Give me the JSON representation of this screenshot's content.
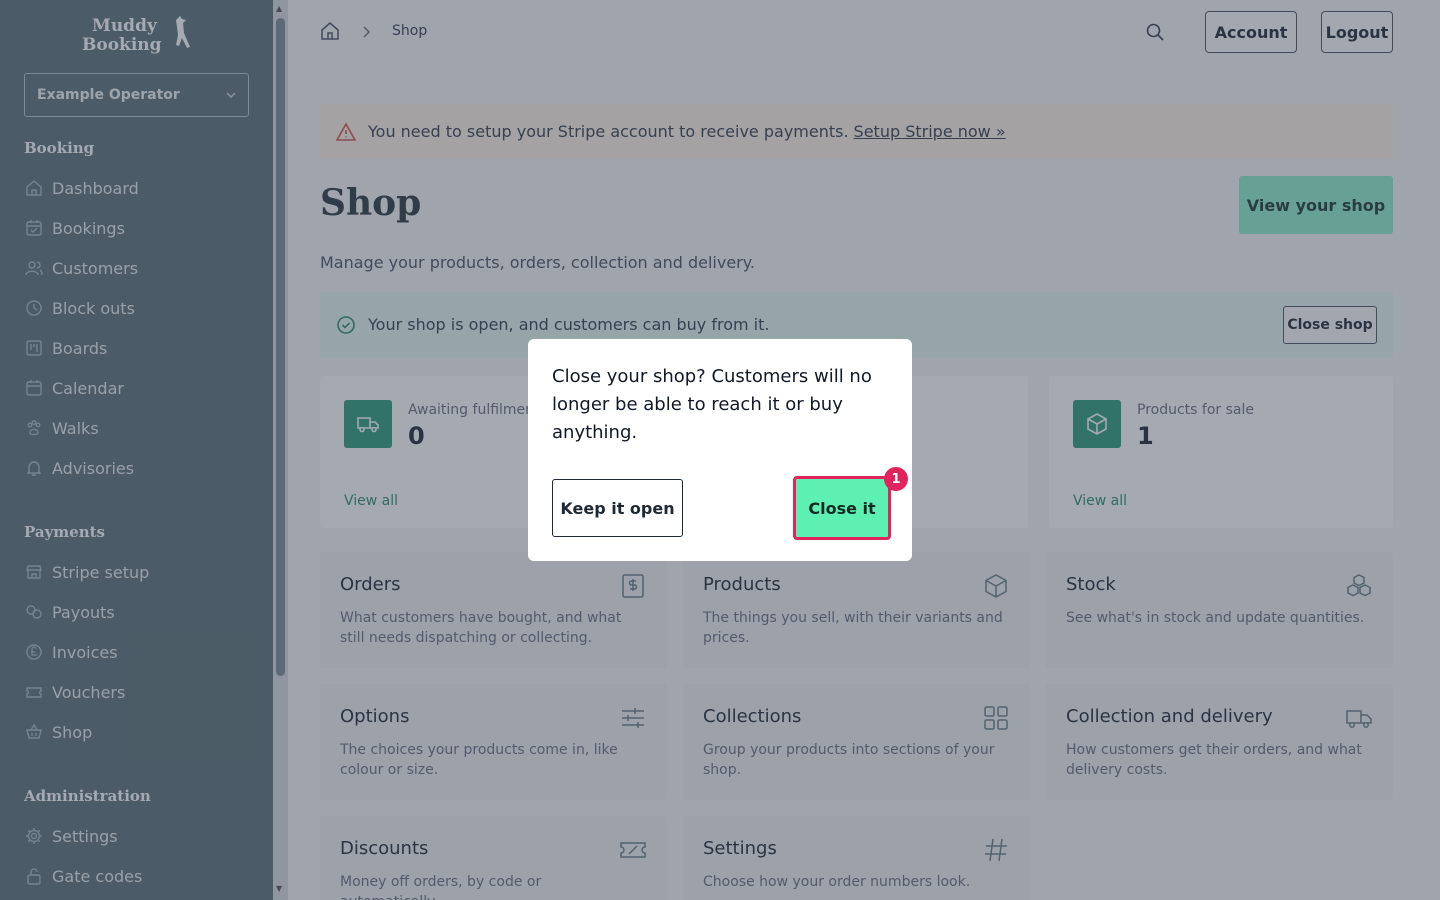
{
  "sidebar": {
    "logo_text": "Muddy Booking",
    "operator": "Example Operator",
    "sections": [
      {
        "title": "Booking"
      },
      {
        "title": "Payments"
      },
      {
        "title": "Administration"
      }
    ],
    "booking_items": [
      {
        "label": "Dashboard",
        "icon": "home-icon"
      },
      {
        "label": "Bookings",
        "icon": "calendar-check-icon"
      },
      {
        "label": "Customers",
        "icon": "users-icon"
      },
      {
        "label": "Block outs",
        "icon": "clock-icon"
      },
      {
        "label": "Boards",
        "icon": "board-icon"
      },
      {
        "label": "Calendar",
        "icon": "calendar-icon"
      },
      {
        "label": "Walks",
        "icon": "paw-icon"
      },
      {
        "label": "Advisories",
        "icon": "bell-icon"
      }
    ],
    "payment_items": [
      {
        "label": "Stripe setup",
        "icon": "store-icon"
      },
      {
        "label": "Payouts",
        "icon": "coins-icon"
      },
      {
        "label": "Invoices",
        "icon": "pound-icon"
      },
      {
        "label": "Vouchers",
        "icon": "ticket-icon"
      },
      {
        "label": "Shop",
        "icon": "basket-icon"
      }
    ],
    "admin_items": [
      {
        "label": "Settings",
        "icon": "gear-icon"
      },
      {
        "label": "Gate codes",
        "icon": "lock-icon"
      }
    ]
  },
  "header": {
    "breadcrumb": "Shop",
    "account_label": "Account",
    "logout_label": "Logout"
  },
  "alert_warning": {
    "text": "You need to setup your Stripe account to receive payments.",
    "link": "Setup Stripe now »"
  },
  "page": {
    "title": "Shop",
    "view_shop_label": "View your shop",
    "subtitle": "Manage your products, orders, collection and delivery."
  },
  "alert_ok": {
    "text": "Your shop is open, and customers can buy from it.",
    "button": "Close shop"
  },
  "stats": [
    {
      "label": "Awaiting fulfilment",
      "value": "0",
      "link": "View all",
      "icon": "truck-icon"
    },
    {
      "label": "Products for sale",
      "value": "1",
      "link": "View all",
      "icon": "box-icon"
    }
  ],
  "tiles": [
    {
      "title": "Orders",
      "desc": "What customers have bought, and what still needs dispatching or collecting.",
      "icon": "receipt-icon"
    },
    {
      "title": "Products",
      "desc": "The things you sell, with their variants and prices.",
      "icon": "box-icon"
    },
    {
      "title": "Stock",
      "desc": "See what's in stock and update quantities.",
      "icon": "boxes-icon"
    },
    {
      "title": "Options",
      "desc": "The choices your products come in, like colour or size.",
      "icon": "sliders-icon"
    },
    {
      "title": "Collections",
      "desc": "Group your products into sections of your shop.",
      "icon": "grid-icon"
    },
    {
      "title": "Collection and delivery",
      "desc": "How customers get their orders, and what delivery costs.",
      "icon": "truck-icon"
    },
    {
      "title": "Discounts",
      "desc": "Money off orders, by code or automatically.",
      "icon": "ticket-icon"
    },
    {
      "title": "Settings",
      "desc": "Choose how your order numbers look.",
      "icon": "hash-icon"
    }
  ],
  "modal": {
    "message": "Close your shop? Customers will no longer be able to reach it or buy anything.",
    "keep_label": "Keep it open",
    "close_label": "Close it",
    "badge": "1"
  },
  "colors": {
    "sidebar": "#5b7279",
    "accent_green": "#2f9d7d",
    "primary_button": "#5ef0b3",
    "badge": "#e0245e"
  }
}
